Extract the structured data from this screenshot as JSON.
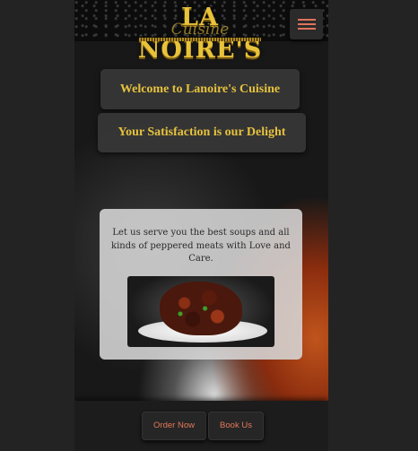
{
  "header": {
    "logo_text": "LA NOIRE'S",
    "logo_sub": "Cuisine",
    "menu_icon": "hamburger-icon",
    "menu_color": "#e0745a"
  },
  "hero": {
    "welcome": "Welcome to Lanoire's Cuisine",
    "tagline": "Your Satisfaction is our Delight"
  },
  "card": {
    "text": "Let us serve you the best soups and all kinds of peppered meats with Love and Care."
  },
  "footer": {
    "order_label": "Order Now",
    "book_label": "Book Us"
  },
  "colors": {
    "accent_gold": "#e6c23e",
    "button_text": "#e47858",
    "page_bg": "#232323"
  }
}
